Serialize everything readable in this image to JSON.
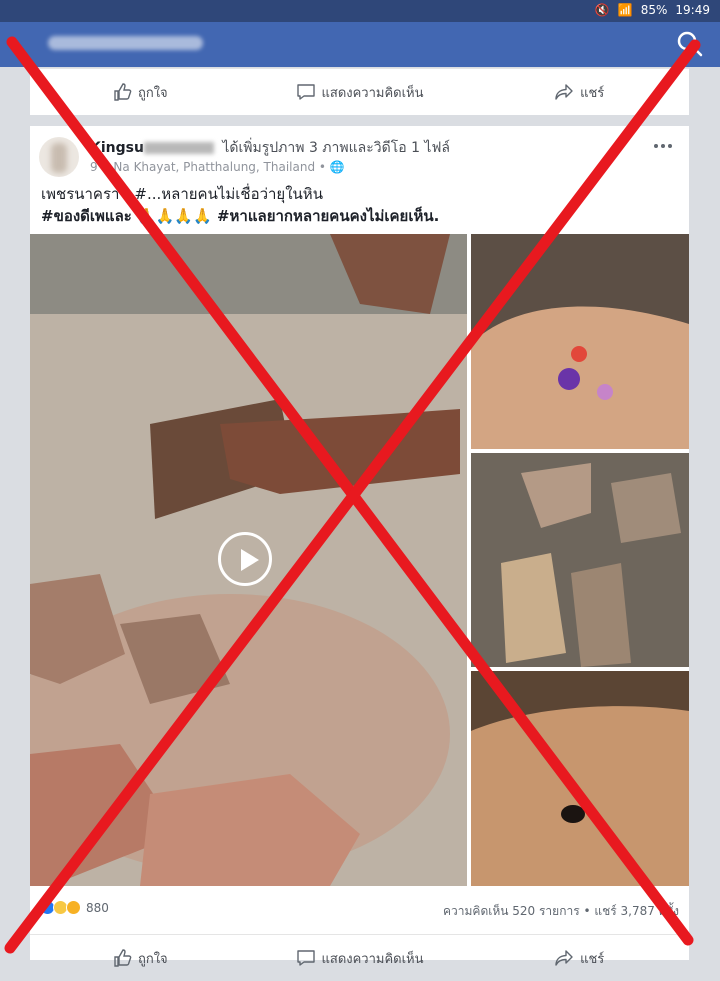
{
  "statusbar": {
    "battery": "85%",
    "time": "19:49"
  },
  "top_actions": {
    "like": "ถูกใจ",
    "comment": "แสดงความคิดเห็น",
    "share": "แชร์"
  },
  "post": {
    "author_partial": "Kingsu",
    "action": "ได้เพิ่มรูปภาพ 3 ภาพและวิดีโอ 1 ไฟล์",
    "time_prefix": "9 ช",
    "location": "Na Khayat, Phatthalung, Thailand",
    "text_line1": "เพชรนาคราช #...หลายคนไม่เชื่อว่ายุในหิน",
    "text_line2": "#ของดีเพและ 🙏🙏🙏🙏 #หาแลยากหลายคนคงไม่เคยเห็น.",
    "reaction_count": "880",
    "comments_shares": "ความคิดเห็น 520 รายการ • แชร์ 3,787 ครั้ง"
  },
  "bottom_actions": {
    "like": "ถูกใจ",
    "comment": "แสดงความคิดเห็น",
    "share": "แชร์"
  },
  "icons": [
    "search-icon",
    "like-icon",
    "comment-icon",
    "share-icon",
    "more-icon",
    "play-icon",
    "globe-icon"
  ],
  "colors": {
    "header": "#4267b2",
    "statusbar": "#2f4779",
    "overlay_x": "#e8191f"
  }
}
